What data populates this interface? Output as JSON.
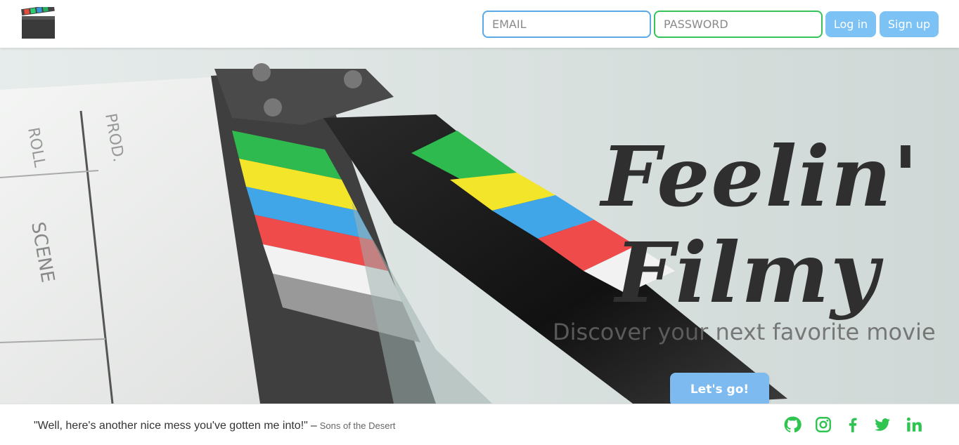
{
  "header": {
    "logo_icon": "clapperboard-icon",
    "email_placeholder": "EMAIL",
    "password_placeholder": "PASSWORD",
    "login_label": "Log in",
    "signup_label": "Sign up"
  },
  "hero": {
    "title_line1": "Feelin'",
    "title_line2": "Filmy",
    "subtitle": "Discover your next favorite movie",
    "cta_label": "Let's go!",
    "background": "clapperboard-photo"
  },
  "footer": {
    "quote": "\"Well, here's another nice mess you've gotten me into!\"",
    "separator": "–",
    "source": "Sons of the Desert",
    "social_icons": [
      "github-icon",
      "instagram-icon",
      "facebook-icon",
      "twitter-icon",
      "linkedin-icon"
    ]
  },
  "colors": {
    "accent_blue": "#7cc2f5",
    "accent_green": "#2ec44f",
    "title_text": "#2f2f2f"
  }
}
